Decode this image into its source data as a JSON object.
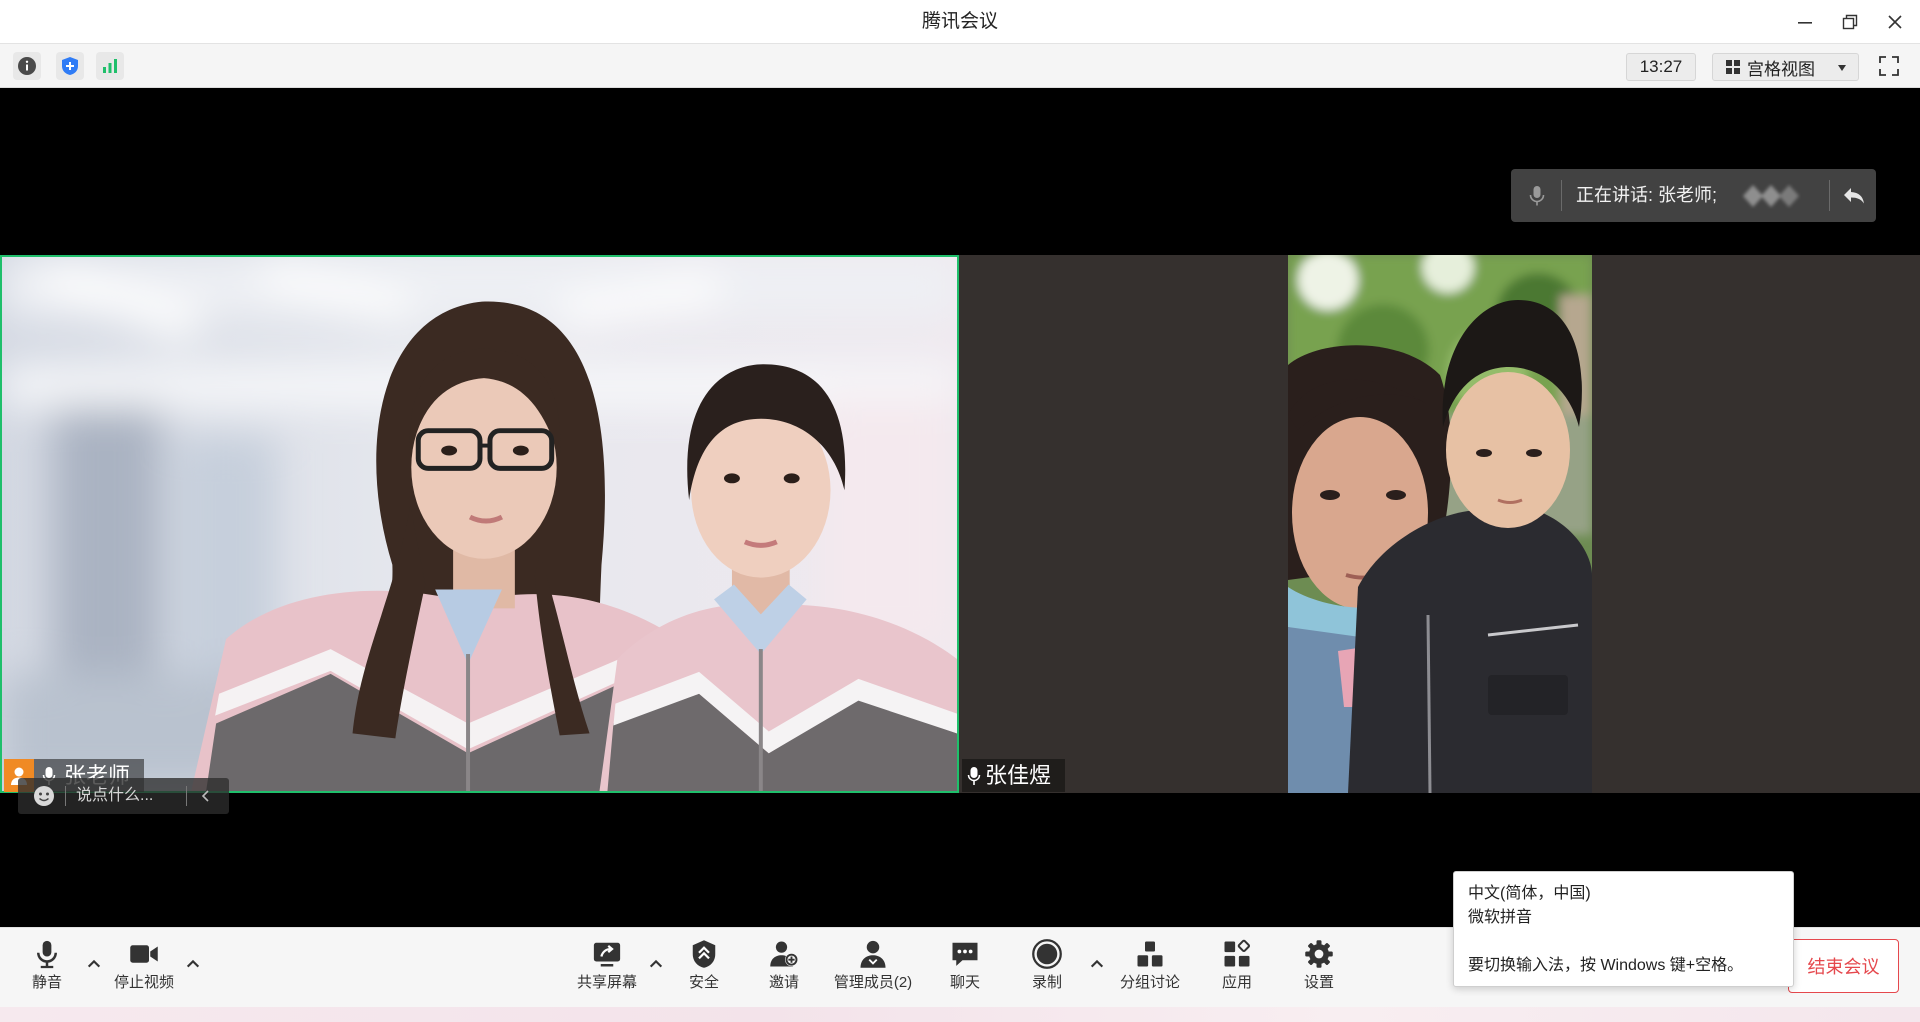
{
  "window": {
    "title": "腾讯会议",
    "controls": [
      "minimize-icon",
      "restore-icon",
      "close-icon"
    ]
  },
  "status_bar": {
    "icons": [
      "info-icon",
      "security-shield-icon",
      "network-signal-icon"
    ],
    "time": "13:27",
    "view_mode": "宫格视图"
  },
  "speaking_indicator": {
    "text": "正在讲话: 张老师;"
  },
  "participants": [
    {
      "name": "张老师"
    },
    {
      "name": "张佳煜"
    }
  ],
  "chat_bar": {
    "placeholder": "说点什么..."
  },
  "toolbar": {
    "mute": "静音",
    "stop_video": "停止视频",
    "share_screen": "共享屏幕",
    "security": "安全",
    "invite": "邀请",
    "manage_members": "管理成员(2)",
    "chat": "聊天",
    "record": "录制",
    "breakout_rooms": "分组讨论",
    "apps": "应用",
    "settings": "设置",
    "end_meeting": "结束会议"
  },
  "ime_tooltip": {
    "language": "中文(简体，中国)",
    "ime_name": "微软拼音",
    "hint": "要切换输入法，按 Windows 键+空格。"
  },
  "icons": {
    "toolbar": [
      "microphone-icon",
      "camera-icon",
      "share-screen-icon",
      "security-shield-icon",
      "invite-user-icon",
      "members-icon",
      "chat-bubble-icon",
      "record-icon",
      "breakout-rooms-icon",
      "apps-icon",
      "gear-icon"
    ],
    "overlay": [
      "microphone-icon",
      "reply-arrow-icon",
      "person-icon",
      "smiley-icon",
      "chevron-left-icon"
    ]
  },
  "colors": {
    "active_speaker_border": "#1fbf6b",
    "end_meeting": "#e5484d",
    "security_icon": "#2f7cf6",
    "signal_icon": "#1fbf6b",
    "participant_badge": "#f08a24",
    "tile_background": "#35302e",
    "stage_background": "#000000"
  }
}
